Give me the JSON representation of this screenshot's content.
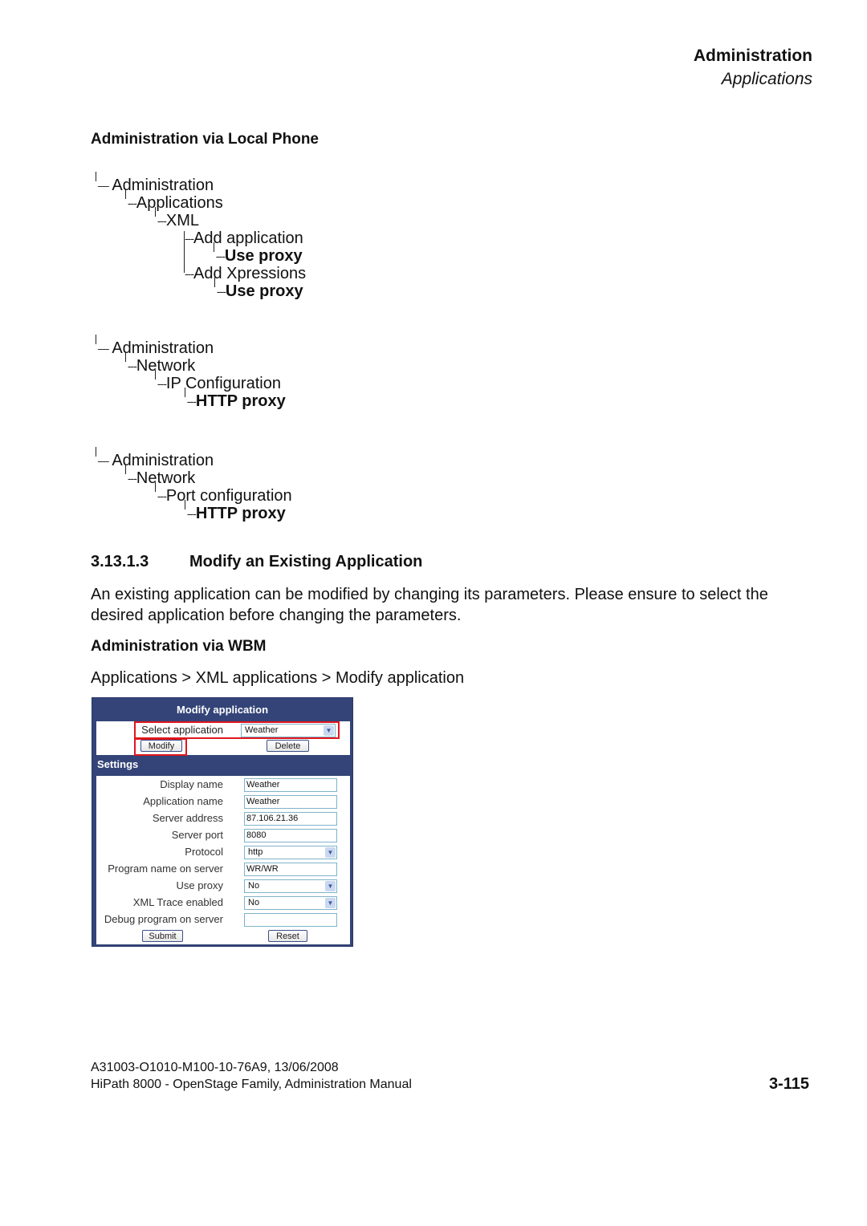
{
  "header": {
    "chapter": "Administration",
    "section": "Applications"
  },
  "local_phone": {
    "heading": "Administration via Local Phone",
    "trees": [
      {
        "lines": [
          {
            "label": "Administration",
            "bold": false
          },
          {
            "label": "Applications",
            "bold": false
          },
          {
            "label": "XML",
            "bold": false
          },
          {
            "label": "Add application",
            "bold": false
          },
          {
            "label": "Use proxy",
            "bold": true
          },
          {
            "label": "Add Xpressions",
            "bold": false
          },
          {
            "label": "Use proxy",
            "bold": true
          }
        ]
      },
      {
        "lines": [
          {
            "label": "Administration",
            "bold": false
          },
          {
            "label": "Network",
            "bold": false
          },
          {
            "label": "IP Configuration",
            "bold": false
          },
          {
            "label": "HTTP proxy",
            "bold": true
          }
        ]
      },
      {
        "lines": [
          {
            "label": "Administration",
            "bold": false
          },
          {
            "label": "Network",
            "bold": false
          },
          {
            "label": "Port configuration",
            "bold": false
          },
          {
            "label": "HTTP proxy",
            "bold": true
          }
        ]
      }
    ],
    "connector": "---"
  },
  "section": {
    "number": "3.13.1.3",
    "title": "Modify an Existing Application",
    "paragraph": "An existing application can be modified by changing its parameters. Please ensure to select the desired application before changing the parameters."
  },
  "wbm": {
    "heading": "Administration via WBM",
    "path": "Applications > XML applications > Modify application",
    "form": {
      "title": "Modify application",
      "select_label": "Select application",
      "select_value": "Weather",
      "modify_button": "Modify",
      "delete_button": "Delete",
      "settings_label": "Settings",
      "fields": [
        {
          "label": "Display name",
          "value": "Weather",
          "type": "text"
        },
        {
          "label": "Application name",
          "value": "Weather",
          "type": "text"
        },
        {
          "label": "Server address",
          "value": "87.106.21.36",
          "type": "text"
        },
        {
          "label": "Server port",
          "value": "8080",
          "type": "text"
        },
        {
          "label": "Protocol",
          "value": "http",
          "type": "select"
        },
        {
          "label": "Program name on server",
          "value": "WR/WR",
          "type": "text"
        },
        {
          "label": "Use proxy",
          "value": "No",
          "type": "select"
        },
        {
          "label": "XML Trace enabled",
          "value": "No",
          "type": "select"
        },
        {
          "label": "Debug program on server",
          "value": "",
          "type": "text"
        }
      ],
      "submit_button": "Submit",
      "reset_button": "Reset",
      "colors": {
        "panel": "#344478",
        "highlight": "#e0161d",
        "input_border": "#7fb3c8"
      }
    }
  },
  "footer": {
    "doc_id": "A31003-O1010-M100-10-76A9, 13/06/2008",
    "manual": "HiPath 8000 - OpenStage Family, Administration Manual",
    "page": "3-115"
  }
}
